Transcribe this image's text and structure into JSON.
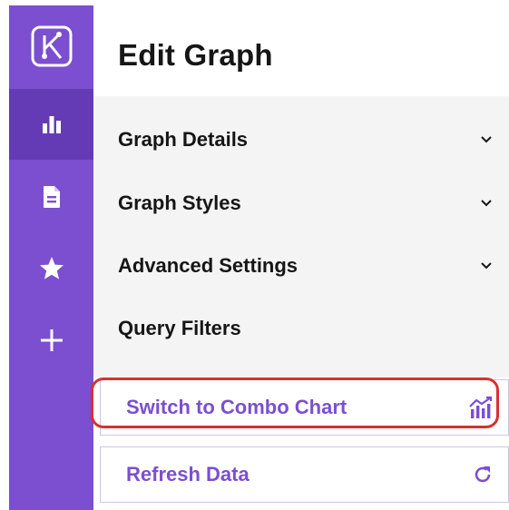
{
  "sidebar": {
    "logo_icon": "app-logo-icon",
    "items": [
      {
        "icon": "bar-chart-icon",
        "active": true
      },
      {
        "icon": "document-icon",
        "active": false
      },
      {
        "icon": "star-icon",
        "active": false
      },
      {
        "icon": "plus-icon",
        "active": false
      }
    ],
    "colors": {
      "background": "#7b4fd0",
      "active": "#643bb5"
    }
  },
  "page": {
    "title": "Edit Graph"
  },
  "accordion": {
    "items": [
      {
        "label": "Graph Details",
        "expandable": true
      },
      {
        "label": "Graph Styles",
        "expandable": true
      },
      {
        "label": "Advanced Settings",
        "expandable": true
      },
      {
        "label": "Query Filters",
        "expandable": false
      }
    ]
  },
  "actions": {
    "combo": {
      "label": "Switch to Combo Chart",
      "icon": "combo-chart-icon"
    },
    "refresh": {
      "label": "Refresh Data",
      "icon": "refresh-icon"
    }
  },
  "colors": {
    "accent": "#7b4fd0",
    "highlight": "#d93030"
  }
}
